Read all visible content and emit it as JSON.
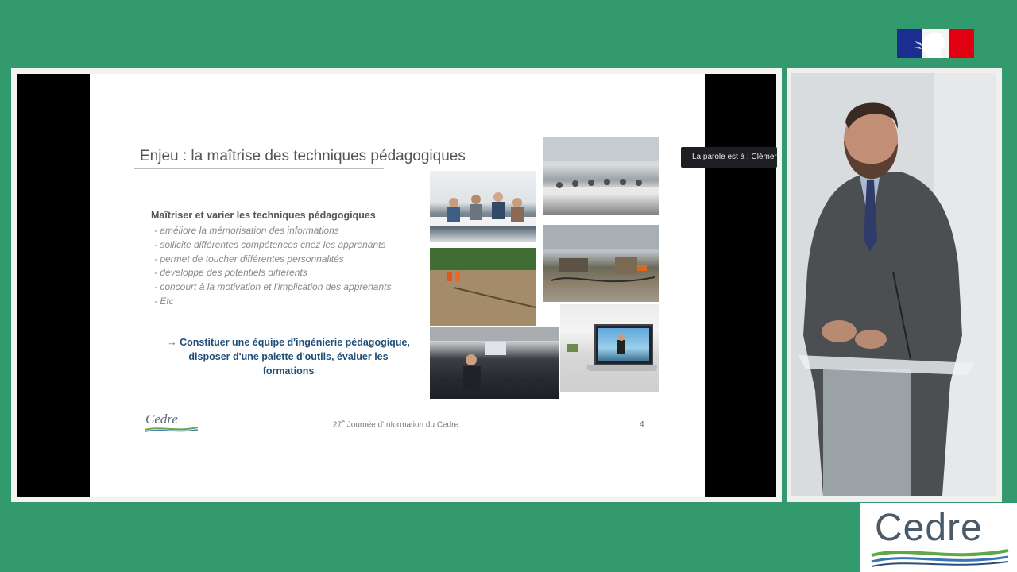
{
  "header": {
    "logo_icon": "marianne-flag-logo",
    "colors": {
      "background": "#329a6c",
      "flag_blue": "#1b2e8f",
      "flag_red": "#e1000f"
    }
  },
  "overlay": {
    "speaker_notice": "La parole est à : Clémer"
  },
  "slide": {
    "title": "Enjeu : la maîtrise des techniques pédagogiques",
    "heading": "Maîtriser et varier les techniques pédagogiques",
    "bullets": [
      "- améliore la mémorisation des informations",
      "- sollicite différentes compétences chez les apprenants",
      "- permet de toucher différentes personnalités",
      "- développe des potentiels différents",
      "- concourt à la motivation et l'implication des apprenants",
      "- Etc"
    ],
    "callout": {
      "arrow": "→",
      "line1": "Constituer une équipe d'ingénierie pédagogique,",
      "line2": "disposer d'une palette d'outils, évaluer les",
      "line3": "formations"
    },
    "footer": {
      "logo_text": "Cedre",
      "event_prefix": "27",
      "event_sup": "e",
      "event_suffix": " Journée d'Information du Cedre",
      "page_number": "4"
    },
    "photos": [
      "classroom-group-photo",
      "conference-room-photo",
      "river-field-exercise-photo",
      "outdoor-equipment-site-photo",
      "auditorium-presentation-photo",
      "laptop-elearning-photo"
    ]
  },
  "speaker_panel": {
    "icon": "speaker-video-feed"
  },
  "brand": {
    "logo_text": "Cedre"
  }
}
